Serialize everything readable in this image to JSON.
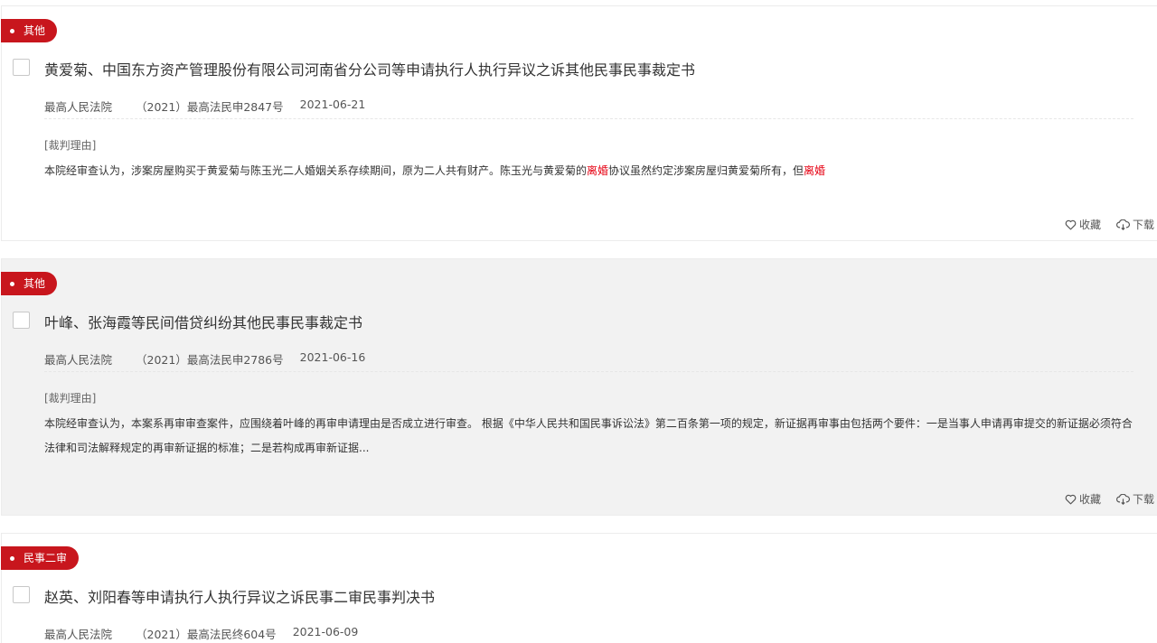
{
  "action_labels": {
    "favorite": "收藏",
    "download": "下载"
  },
  "icons": {
    "favorite": "heart-outline-icon",
    "download": "cloud-download-icon"
  },
  "colors": {
    "tag_bg": "#c8161d",
    "highlight": "#e60012"
  },
  "results": [
    {
      "tag": "其他",
      "title": "黄爱菊、中国东方资产管理股份有限公司河南省分公司等申请执行人执行异议之诉其他民事民事裁定书",
      "court": "最高人民法院",
      "case_no": "（2021）最高法民申2847号",
      "date": "2021-06-21",
      "reason_label": "[裁判理由]",
      "reason_parts": [
        "本院经审查认为，涉案房屋购买于黄爱菊与陈玉光二人婚姻关系存续期间，原为二人共有财产。陈玉光与黄爱菊的",
        "离婚",
        "协议虽然约定涉案房屋归黄爱菊所有，但",
        "离婚"
      ]
    },
    {
      "tag": "其他",
      "title": "叶峰、张海霞等民间借贷纠纷其他民事民事裁定书",
      "court": "最高人民法院",
      "case_no": "（2021）最高法民申2786号",
      "date": "2021-06-16",
      "reason_label": "[裁判理由]",
      "reason_text": "本院经审查认为，本案系再审审查案件，应围绕着叶峰的再审申请理由是否成立进行审查。 根据《中华人民共和国民事诉讼法》第二百条第一项的规定，新证据再审事由包括两个要件：一是当事人申请再审提交的新证据必须符合法律和司法解释规定的再审新证据的标准；二是若构成再审新证据..."
    },
    {
      "tag": "民事二审",
      "title": "赵英、刘阳春等申请执行人执行异议之诉民事二审民事判决书",
      "court": "最高人民法院",
      "case_no": "（2021）最高法民终604号",
      "date": "2021-06-09"
    }
  ]
}
